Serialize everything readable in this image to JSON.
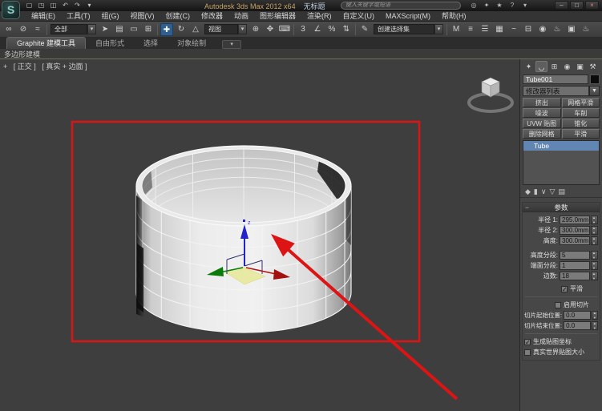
{
  "title_bar": {
    "logo_letter": "S",
    "app_title": "Autodesk 3ds Max 2012 x64",
    "doc_title": "无标题",
    "search_placeholder": "键入关键字或短语",
    "quick_access": [
      {
        "name": "new-scene-icon",
        "glyph": "▢"
      },
      {
        "name": "open-file-icon",
        "glyph": "◳"
      },
      {
        "name": "save-file-icon",
        "glyph": "◫"
      },
      {
        "name": "undo-icon",
        "glyph": "↶"
      },
      {
        "name": "redo-icon",
        "glyph": "↷"
      },
      {
        "name": "quick-access-dropdown-icon",
        "glyph": "▾"
      }
    ],
    "utility_icons": [
      {
        "name": "search-icon",
        "glyph": "◎"
      },
      {
        "name": "communication-center-icon",
        "glyph": "✦"
      },
      {
        "name": "favorites-icon",
        "glyph": "★"
      },
      {
        "name": "help-icon",
        "glyph": "?"
      },
      {
        "name": "help-dropdown-icon",
        "glyph": "▾"
      }
    ],
    "window_buttons": [
      {
        "name": "minimize-button",
        "glyph": "–"
      },
      {
        "name": "maximize-button",
        "glyph": "□"
      },
      {
        "name": "close-button",
        "glyph": "×",
        "close": true
      }
    ]
  },
  "menu_bar": {
    "items": [
      {
        "name": "menu-edit",
        "label": "编辑(E)"
      },
      {
        "name": "menu-tools",
        "label": "工具(T)"
      },
      {
        "name": "menu-group",
        "label": "组(G)"
      },
      {
        "name": "menu-views",
        "label": "视图(V)"
      },
      {
        "name": "menu-create",
        "label": "创建(C)"
      },
      {
        "name": "menu-modifiers",
        "label": "修改器"
      },
      {
        "name": "menu-animation",
        "label": "动画"
      },
      {
        "name": "menu-graph-editors",
        "label": "图形编辑器"
      },
      {
        "name": "menu-rendering",
        "label": "渲染(R)"
      },
      {
        "name": "menu-customize",
        "label": "自定义(U)"
      },
      {
        "name": "menu-maxscript",
        "label": "MAXScript(M)"
      },
      {
        "name": "menu-help",
        "label": "帮助(H)"
      }
    ]
  },
  "main_toolbar": {
    "group1": [
      {
        "name": "select-and-link-icon",
        "glyph": "∞"
      },
      {
        "name": "unlink-selection-icon",
        "glyph": "⊘"
      },
      {
        "name": "bind-to-space-warp-icon",
        "glyph": "≈"
      }
    ],
    "selection_filter_value": "全部",
    "group2": [
      {
        "name": "select-object-icon",
        "glyph": "➤"
      },
      {
        "name": "select-by-name-icon",
        "glyph": "▤"
      },
      {
        "name": "rectangular-selection-icon",
        "glyph": "▭"
      },
      {
        "name": "window-crossing-icon",
        "glyph": "⊞"
      }
    ],
    "group3": [
      {
        "name": "select-and-move-icon",
        "glyph": "✚",
        "active": true
      },
      {
        "name": "select-and-rotate-icon",
        "glyph": "↻"
      },
      {
        "name": "select-and-scale-icon",
        "glyph": "△"
      }
    ],
    "coord_system_value": "视图",
    "group4": [
      {
        "name": "use-pivot-center-icon",
        "glyph": "⊕"
      },
      {
        "name": "select-and-manipulate-icon",
        "glyph": "✥"
      },
      {
        "name": "keyboard-override-icon",
        "glyph": "⌨"
      }
    ],
    "group5": [
      {
        "name": "snap-toggle-3d-icon",
        "glyph": "3"
      },
      {
        "name": "angle-snap-icon",
        "glyph": "∠"
      },
      {
        "name": "percent-snap-icon",
        "glyph": "%"
      },
      {
        "name": "spinner-snap-icon",
        "glyph": "⇅"
      }
    ],
    "group6": [
      {
        "name": "edit-named-selections-icon",
        "glyph": "✎"
      }
    ],
    "named_sets_value": "创建选择集",
    "group7": [
      {
        "name": "mirror-icon",
        "glyph": "M"
      },
      {
        "name": "align-icon",
        "glyph": "≡"
      },
      {
        "name": "layer-manager-icon",
        "glyph": "☰"
      },
      {
        "name": "graphite-toggle-icon",
        "glyph": "▦"
      },
      {
        "name": "curve-editor-icon",
        "glyph": "~"
      },
      {
        "name": "schematic-view-icon",
        "glyph": "⊟"
      },
      {
        "name": "material-editor-icon",
        "glyph": "◉"
      },
      {
        "name": "render-setup-icon",
        "glyph": "♨"
      },
      {
        "name": "rendered-frame-icon",
        "glyph": "▣"
      },
      {
        "name": "render-production-icon",
        "glyph": "♨"
      }
    ]
  },
  "ribbon": {
    "tabs": [
      {
        "name": "tab-graphite-modeling-tools",
        "label": "Graphite 建模工具",
        "active": true
      },
      {
        "name": "tab-freeform",
        "label": "自由形式"
      },
      {
        "name": "tab-selection",
        "label": "选择"
      },
      {
        "name": "tab-object-paint",
        "label": "对象绘制"
      }
    ],
    "collapse_glyph": "▾",
    "panel_title": "多边形建模"
  },
  "viewport": {
    "label_plus": "+",
    "label_pov": "[ 正交 ]",
    "label_shading": "[ 真实 + 边面 ]",
    "gizmo_z": "z"
  },
  "command_panel": {
    "tabs": [
      {
        "name": "tab-create-icon",
        "glyph": "✦"
      },
      {
        "name": "tab-modify-icon",
        "glyph": "◡",
        "active": true
      },
      {
        "name": "tab-hierarchy-icon",
        "glyph": "⊞"
      },
      {
        "name": "tab-motion-icon",
        "glyph": "◉"
      },
      {
        "name": "tab-display-icon",
        "glyph": "▣"
      },
      {
        "name": "tab-utilities-icon",
        "glyph": "⚒"
      }
    ],
    "object_name": "Tube001",
    "modifier_list_label": "修改器列表",
    "dropdown_arrow": "▼",
    "modifier_buttons": [
      {
        "name": "btn-extrude",
        "label": "挤出"
      },
      {
        "name": "btn-mesh-smooth",
        "label": "网格平滑"
      },
      {
        "name": "btn-noise",
        "label": "噪波"
      },
      {
        "name": "btn-lathe",
        "label": "车削"
      },
      {
        "name": "btn-uvw-map",
        "label": "UVW 贴图"
      },
      {
        "name": "btn-taper",
        "label": "锥化"
      },
      {
        "name": "btn-delete-mesh",
        "label": "删除网格"
      },
      {
        "name": "btn-smooth",
        "label": "平滑"
      }
    ],
    "stack_items": [
      {
        "name": "stack-item-tube",
        "label": "Tube",
        "selected": true
      }
    ],
    "stack_tools": [
      {
        "name": "pin-stack-icon",
        "glyph": "◆"
      },
      {
        "name": "show-end-result-icon",
        "glyph": "▮"
      },
      {
        "name": "make-unique-icon",
        "glyph": "∨"
      },
      {
        "name": "remove-modifier-icon",
        "glyph": "▽"
      },
      {
        "name": "configure-modifier-sets-icon",
        "glyph": "▤"
      }
    ],
    "parameters": {
      "title": "参数",
      "collapse_glyph": "−",
      "spin_fields": [
        {
          "name": "field-radius1",
          "label": "半径 1:",
          "value": "295.0mm"
        },
        {
          "name": "field-radius2",
          "label": "半径 2:",
          "value": "300.0mm"
        },
        {
          "name": "field-height",
          "label": "高度:",
          "value": "300.0mm"
        },
        {
          "name": "field-height-segs",
          "label": "高度分段:",
          "value": "5",
          "gap": true
        },
        {
          "name": "field-cap-segs",
          "label": "端面分段:",
          "value": "1"
        },
        {
          "name": "field-sides",
          "label": "边数:",
          "value": "18"
        }
      ],
      "smooth_checkbox": {
        "label": "平滑",
        "checked": true
      },
      "slice_checkbox": {
        "label": "启用切片",
        "checked": false
      },
      "slice_fields": [
        {
          "name": "field-slice-from",
          "label": "切片起始位置:",
          "value": "0.0"
        },
        {
          "name": "field-slice-to",
          "label": "切片结束位置:",
          "value": "0.0"
        }
      ],
      "map_coords_checkbox": {
        "label": "生成贴图坐标",
        "checked": true
      },
      "real_world_checkbox": {
        "label": "真实世界贴图大小",
        "checked": false
      }
    }
  },
  "colors": {
    "annotation_red": "#dd1414",
    "selection_blue": "#6286b4",
    "gizmo_z_blue": "#2323cc",
    "gizmo_x_red": "#b31111",
    "gizmo_y_green": "#0b7d0b"
  }
}
